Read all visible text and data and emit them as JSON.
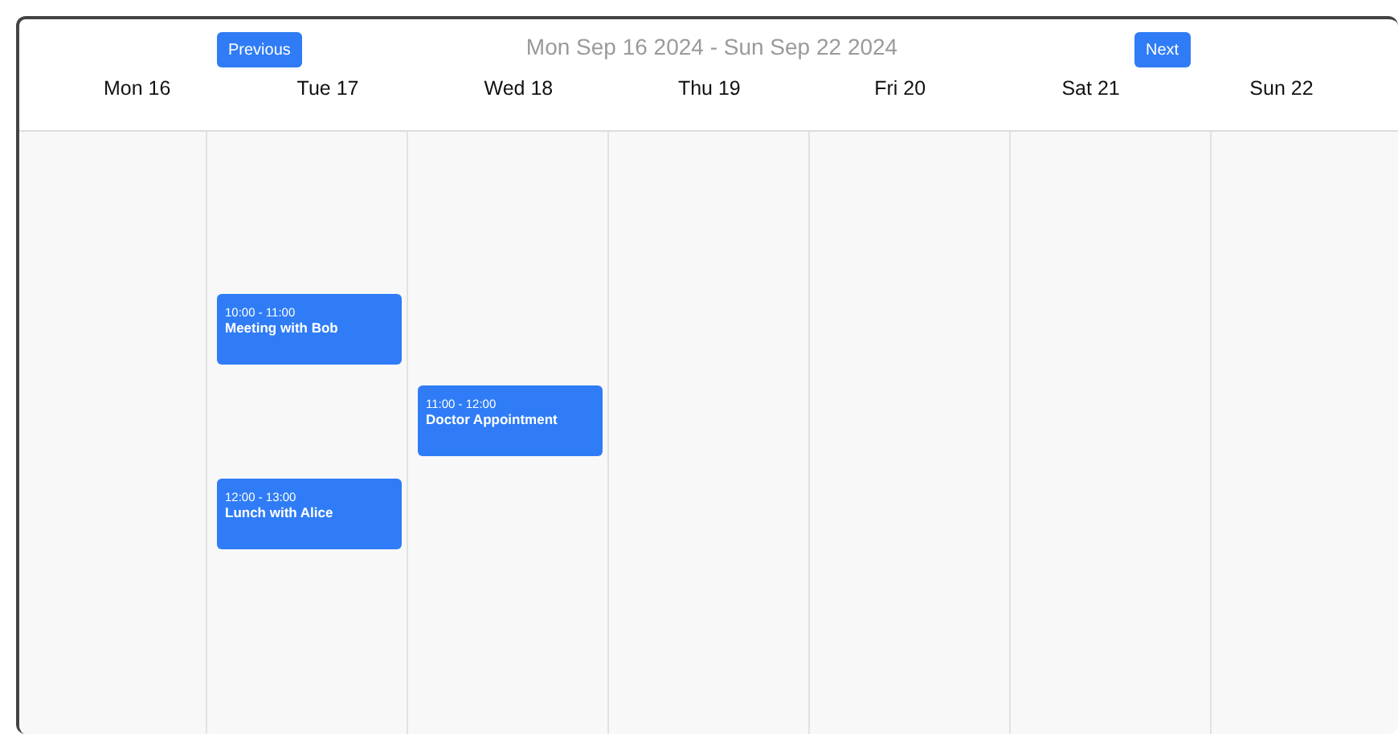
{
  "header": {
    "previous_button": "Previous",
    "range_title": "Mon Sep 16 2024 - Sun Sep 22 2024",
    "next_button": "Next"
  },
  "days": [
    {
      "label": "Mon 16"
    },
    {
      "label": "Tue 17",
      "events": [
        {
          "time": "10:00 - 11:00",
          "title": "Meeting with Bob"
        },
        {
          "time": "12:00 - 13:00",
          "title": "Lunch with Alice"
        }
      ]
    },
    {
      "label": "Wed 18",
      "events": [
        {
          "time": "11:00 - 12:00",
          "title": "Doctor Appointment"
        }
      ]
    },
    {
      "label": "Thu 19"
    },
    {
      "label": "Fri 20"
    },
    {
      "label": "Sat 21"
    },
    {
      "label": "Sun 22"
    }
  ]
}
